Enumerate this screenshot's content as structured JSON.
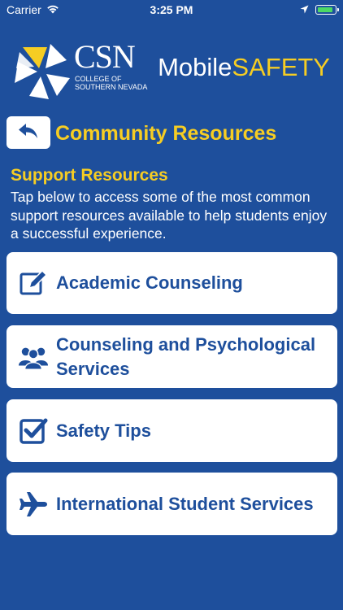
{
  "status_bar": {
    "carrier": "Carrier",
    "time": "3:25 PM"
  },
  "header": {
    "org_short": "CSN",
    "org_full": "COLLEGE OF SOUTHERN NEVADA",
    "brand_mobile": "Mobile",
    "brand_safety": "SAFETY"
  },
  "page": {
    "title": "Community Resources"
  },
  "section": {
    "title": "Support Resources",
    "description": "Tap below to access some of the most common support resources available to help students enjoy a successful experience."
  },
  "resources": [
    {
      "label": "Academic Counseling",
      "icon": "edit-icon"
    },
    {
      "label": "Counseling and Psychological Services",
      "icon": "users-icon"
    },
    {
      "label": "Safety Tips",
      "icon": "checkbox-icon"
    },
    {
      "label": "International Student Services",
      "icon": "airplane-icon"
    }
  ],
  "colors": {
    "background": "#1e4f9c",
    "accent_yellow": "#f6cd23",
    "card": "#ffffff",
    "battery": "#4cd964"
  }
}
